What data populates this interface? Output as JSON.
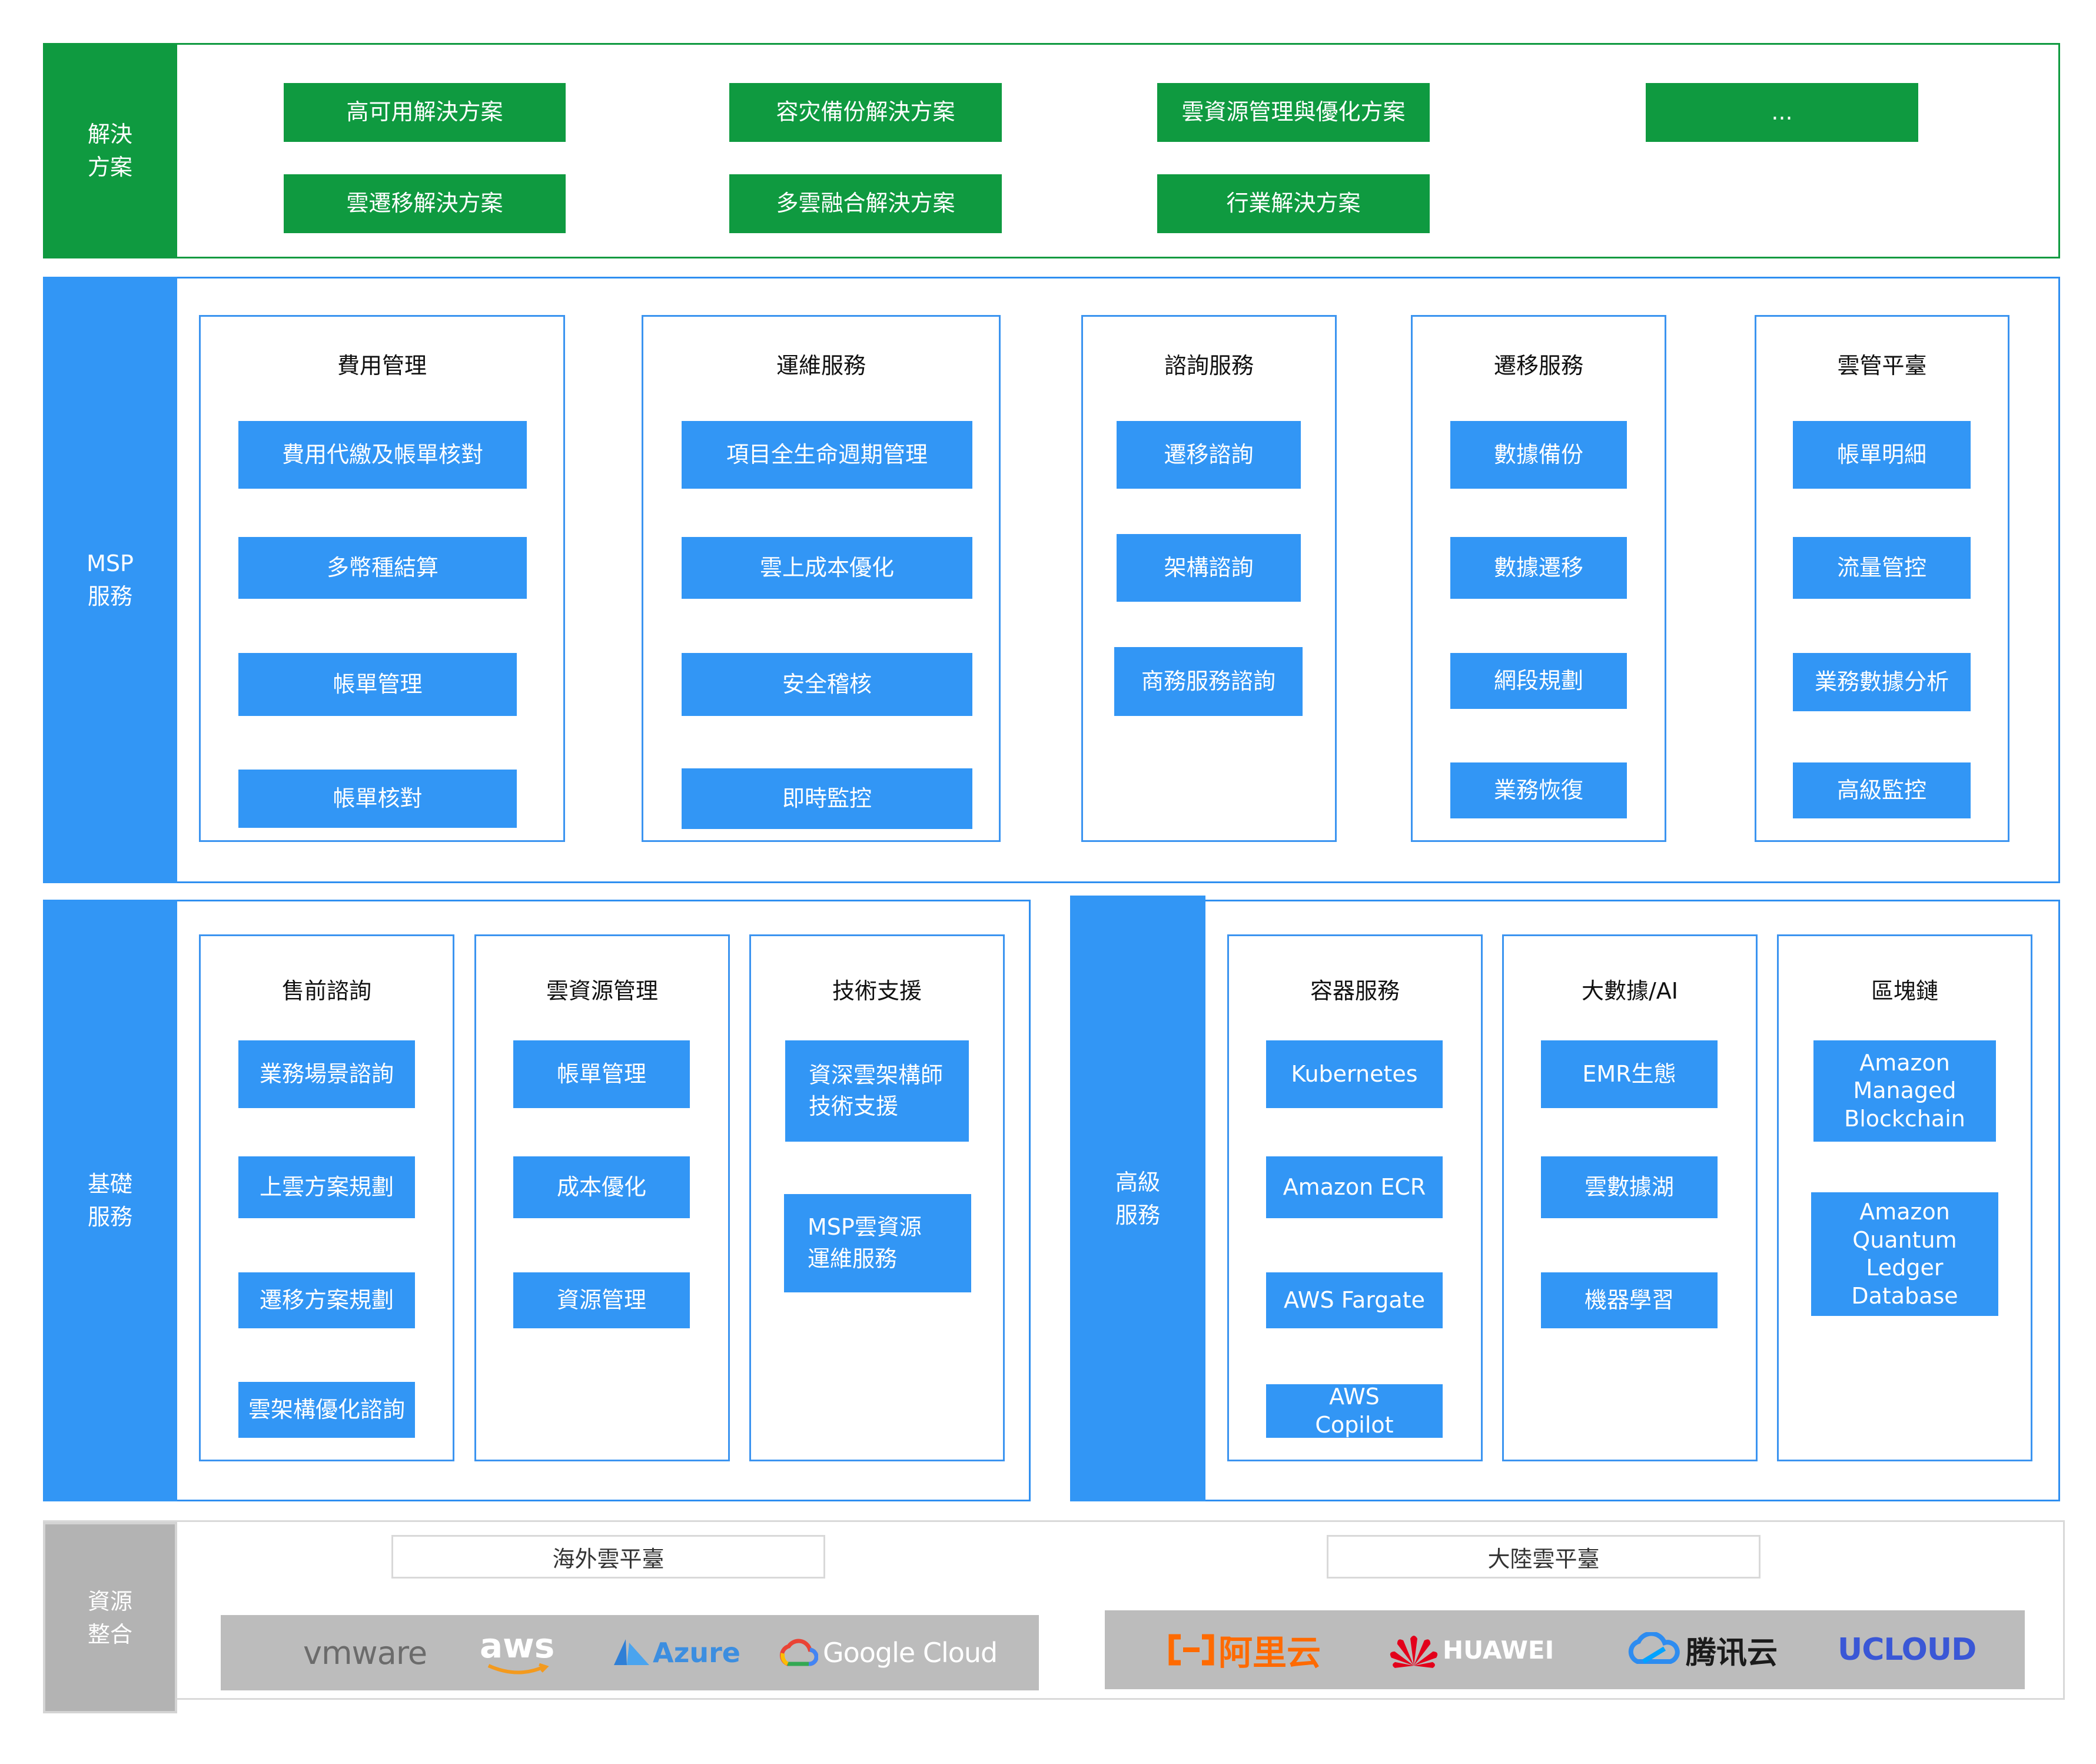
{
  "solutions": {
    "side_label": "解決\n方案",
    "items": [
      "高可用解決方案",
      "容灾備份解決方案",
      "雲資源管理與優化方案",
      "...",
      "雲遷移解決方案",
      "多雲融合解決方案",
      "行業解決方案"
    ]
  },
  "msp": {
    "side_label": "MSP\n服務",
    "groups": [
      {
        "title": "費用管理",
        "items": [
          "費用代繳及帳單核對",
          "多幣種結算",
          "帳單管理",
          "帳單核對"
        ]
      },
      {
        "title": "運維服務",
        "items": [
          "項目全生命週期管理",
          "雲上成本優化",
          "安全稽核",
          "即時監控"
        ]
      },
      {
        "title": "諮詢服務",
        "items": [
          "遷移諮詢",
          "架構諮詢",
          "商務服務諮詢"
        ]
      },
      {
        "title": "遷移服務",
        "items": [
          "數據備份",
          "數據遷移",
          "網段規劃",
          "業務恢復"
        ]
      },
      {
        "title": "雲管平臺",
        "items": [
          "帳單明細",
          "流量管控",
          "業務數據分析",
          "高級監控"
        ]
      }
    ]
  },
  "basic": {
    "side_label": "基礎\n服務",
    "groups": [
      {
        "title": "售前諮詢",
        "items": [
          "業務場景諮詢",
          "上雲方案規劃",
          "遷移方案規劃",
          "雲架構優化諮詢"
        ]
      },
      {
        "title": "雲資源管理",
        "items": [
          "帳單管理",
          "成本優化",
          "資源管理"
        ]
      },
      {
        "title": "技術支援",
        "items": [
          "資深雲架構師\n技術支援",
          "MSP雲資源\n運維服務"
        ]
      }
    ]
  },
  "advanced": {
    "side_label": "高級\n服務",
    "groups": [
      {
        "title": "容器服務",
        "items": [
          "Kubernetes",
          "Amazon ECR",
          "AWS Fargate",
          "AWS\nCopilot"
        ]
      },
      {
        "title": "大數據/AI",
        "items": [
          "EMR生態",
          "雲數據湖",
          "機器學習"
        ]
      },
      {
        "title": "區塊鏈",
        "items": [
          "Amazon\nManaged\nBlockchain",
          "Amazon\nQuantum\nLedger\nDatabase"
        ]
      }
    ]
  },
  "resources": {
    "side_label": "資源\n整合",
    "overseas": {
      "label": "海外雲平臺",
      "logos": [
        "vmware",
        "aws",
        "Azure",
        "Google Cloud"
      ]
    },
    "mainland": {
      "label": "大陸雲平臺",
      "logos": [
        "阿里云",
        "HUAWEI",
        "腾讯云",
        "UCLOUD"
      ]
    }
  },
  "colors": {
    "green": "#0f9a40",
    "blue": "#3296f5",
    "gray": "#b3b3b3"
  }
}
